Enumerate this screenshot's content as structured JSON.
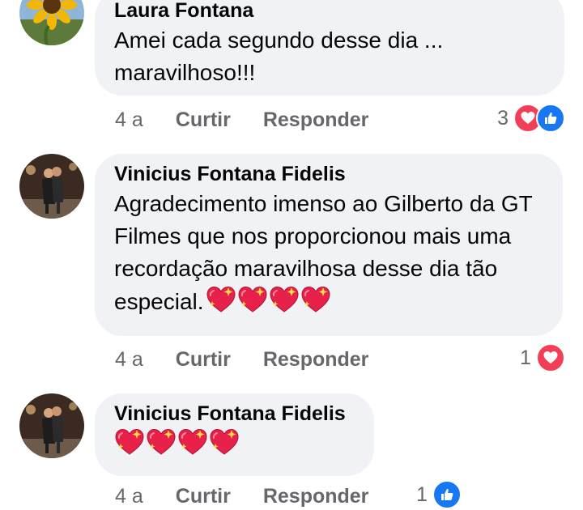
{
  "colors": {
    "bubble": "#f0f2f5",
    "secondary_text": "#65676b",
    "love": "#f33e58",
    "like": "#1877f2"
  },
  "comments": [
    {
      "author": "Laura Fontana",
      "text": "Amei cada segundo desse dia ... maravilhoso!!!",
      "age": "4 a",
      "like_label": "Curtir",
      "reply_label": "Responder",
      "reaction_count": "3",
      "reactions": [
        "love-icon",
        "like-icon"
      ]
    },
    {
      "author": "Vinicius Fontana Fidelis",
      "text": "Agradecimento imenso ao Gilberto da GT Filmes que nos proporcionou mais uma recordação maravilhosa desse dia tão especial.",
      "emoji": [
        "sparkling-heart-icon",
        "sparkling-heart-icon",
        "sparkling-heart-icon",
        "sparkling-heart-icon"
      ],
      "age": "4 a",
      "like_label": "Curtir",
      "reply_label": "Responder",
      "reaction_count": "1",
      "reactions": [
        "love-icon"
      ]
    },
    {
      "author": "Vinicius Fontana Fidelis",
      "text": "",
      "emoji": [
        "sparkling-heart-icon",
        "sparkling-heart-icon",
        "sparkling-heart-icon",
        "sparkling-heart-icon"
      ],
      "age": "4 a",
      "like_label": "Curtir",
      "reply_label": "Responder",
      "reaction_count": "1",
      "reactions": [
        "like-icon"
      ]
    }
  ]
}
